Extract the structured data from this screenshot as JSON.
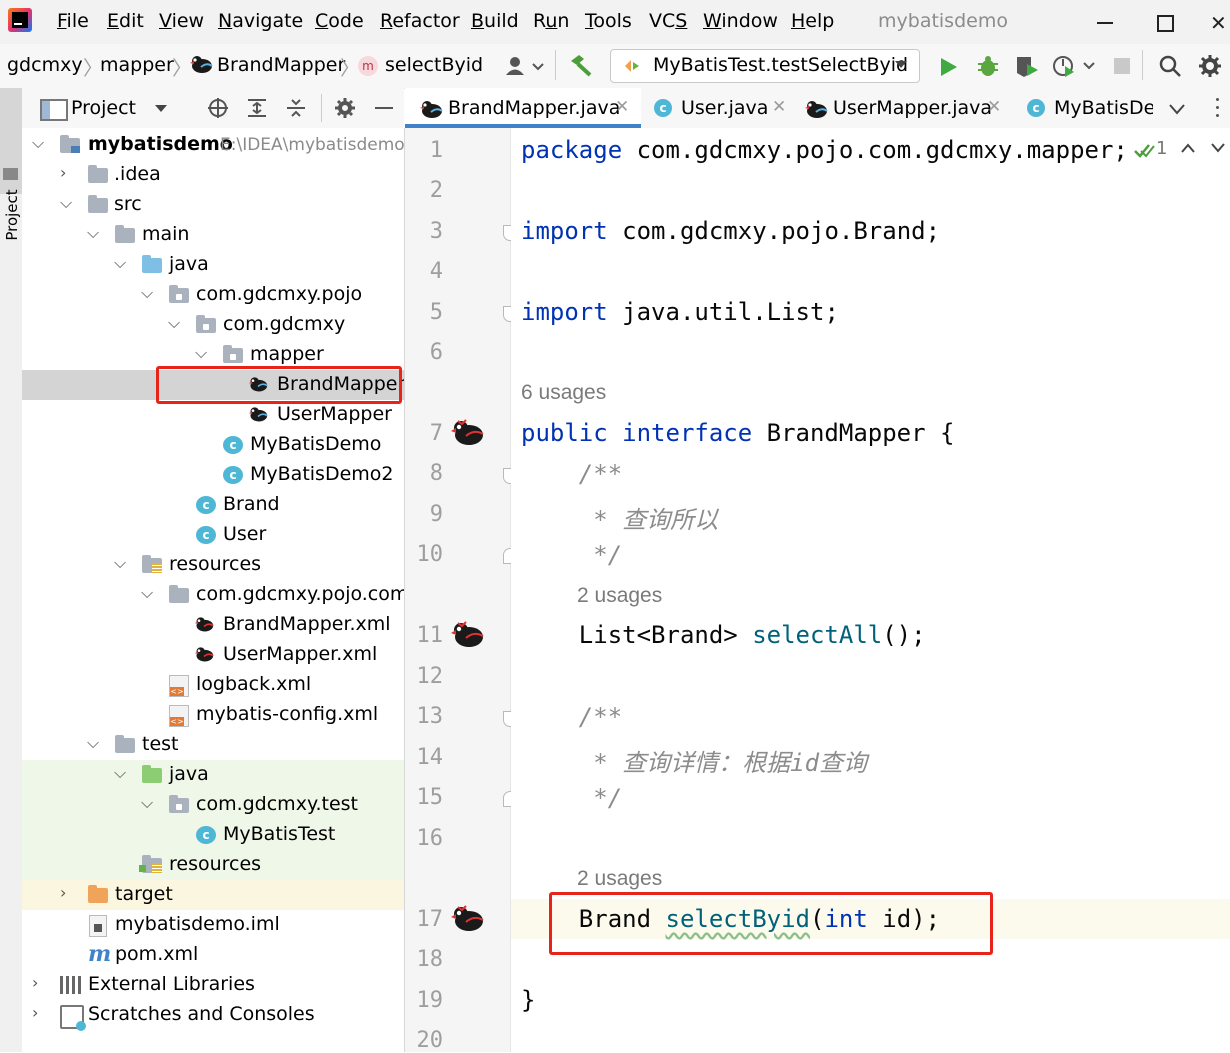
{
  "menubar": {
    "items": [
      {
        "pre": "",
        "u": "F",
        "post": "ile"
      },
      {
        "pre": "",
        "u": "E",
        "post": "dit"
      },
      {
        "pre": "",
        "u": "V",
        "post": "iew"
      },
      {
        "pre": "",
        "u": "N",
        "post": "avigate"
      },
      {
        "pre": "",
        "u": "C",
        "post": "ode"
      },
      {
        "pre": "",
        "u": "R",
        "post": "efactor"
      },
      {
        "pre": "",
        "u": "B",
        "post": "uild"
      },
      {
        "pre": "R",
        "u": "u",
        "post": "n"
      },
      {
        "pre": "",
        "u": "T",
        "post": "ools"
      },
      {
        "pre": "VC",
        "u": "S",
        "post": ""
      },
      {
        "pre": "",
        "u": "W",
        "post": "indow"
      },
      {
        "pre": "",
        "u": "H",
        "post": "elp"
      }
    ],
    "app_title": "mybatisdemo"
  },
  "breadcrumb": {
    "items": [
      "gdcmxy",
      "mapper",
      "BrandMapper",
      "selectByid"
    ]
  },
  "run_config": {
    "label": "MyBatisTest.testSelectByid"
  },
  "project_panel": {
    "title": "Project",
    "strip_label": "Project",
    "tree": [
      {
        "label": "mybatisdemo",
        "suffix": "E:\\IDEA\\mybatisdemo",
        "bold": true
      },
      {
        "label": ".idea"
      },
      {
        "label": "src"
      },
      {
        "label": "main"
      },
      {
        "label": "java"
      },
      {
        "label": "com.gdcmxy.pojo"
      },
      {
        "label": "com.gdcmxy"
      },
      {
        "label": "mapper"
      },
      {
        "label": "BrandMapper"
      },
      {
        "label": "UserMapper"
      },
      {
        "label": "MyBatisDemo"
      },
      {
        "label": "MyBatisDemo2"
      },
      {
        "label": "Brand"
      },
      {
        "label": "User"
      },
      {
        "label": "resources"
      },
      {
        "label": "com.gdcmxy.pojo.com.gdcmxy.mapper"
      },
      {
        "label": "BrandMapper.xml"
      },
      {
        "label": "UserMapper.xml"
      },
      {
        "label": "logback.xml"
      },
      {
        "label": "mybatis-config.xml"
      },
      {
        "label": "test"
      },
      {
        "label": "java"
      },
      {
        "label": "com.gdcmxy.test"
      },
      {
        "label": "MyBatisTest"
      },
      {
        "label": "resources"
      },
      {
        "label": "target"
      },
      {
        "label": "mybatisdemo.iml"
      },
      {
        "label": "pom.xml"
      },
      {
        "label": "External Libraries"
      },
      {
        "label": "Scratches and Consoles"
      }
    ]
  },
  "editor": {
    "tabs": [
      {
        "label": "BrandMapper.java",
        "active": true,
        "closable": true
      },
      {
        "label": "User.java",
        "active": false,
        "closable": true
      },
      {
        "label": "UserMapper.java",
        "active": false,
        "closable": true
      },
      {
        "label": "MyBatisDemo",
        "active": false,
        "closable": false
      }
    ],
    "inspection_count": "1",
    "line_numbers": [
      "1",
      "2",
      "3",
      "4",
      "5",
      "6",
      "7",
      "8",
      "9",
      "10",
      "11",
      "12",
      "13",
      "14",
      "15",
      "16",
      "17",
      "18",
      "19",
      "20"
    ],
    "code": {
      "l1_kw": "package",
      "l1_rest": " com.gdcmxy.pojo.com.gdcmxy.mapper;",
      "l3_kw": "import",
      "l3_rest": " com.gdcmxy.pojo.Brand;",
      "l5_kw": "import",
      "l5_rest": " java.util.List;",
      "usage_interface": "6 usages",
      "l7_kw": "public interface",
      "l7_rest": " BrandMapper {",
      "l8": "    /**",
      "l9": "     * 查询所以",
      "l10": "     */",
      "usage_selectall": "2 usages",
      "l11_pre": "    List<Brand> ",
      "l11_fn": "selectAll",
      "l11_post": "();",
      "l13": "    /**",
      "l14": "     * 查询详情：根据id查询",
      "l15": "     */",
      "usage_selectbyid": "2 usages",
      "l17_pre": "    Brand ",
      "l17_fn": "selectByid",
      "l17_p1": "(",
      "l17_kw": "int",
      "l17_post": " id);",
      "l19": "}"
    }
  }
}
